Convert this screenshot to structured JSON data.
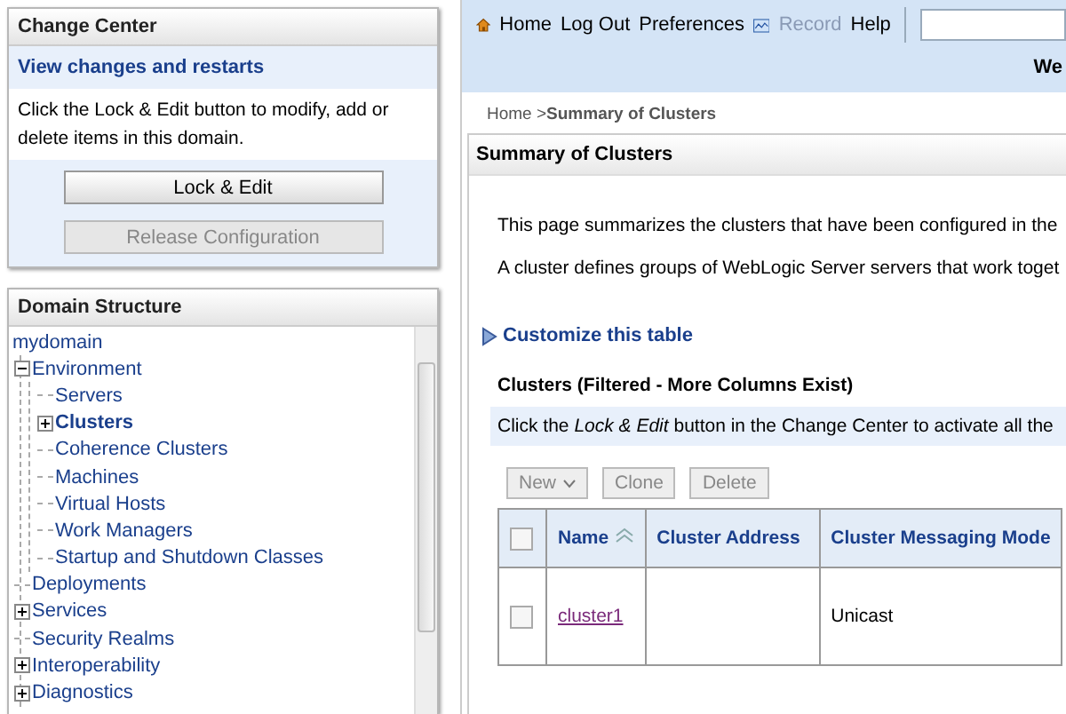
{
  "change_center": {
    "title": "Change Center",
    "subtitle": "View changes and restarts",
    "text": "Click the Lock & Edit button to modify, add or delete items in this domain.",
    "buttons": [
      {
        "label": "Lock & Edit",
        "disabled": false
      },
      {
        "label": "Release Configuration",
        "disabled": true
      }
    ]
  },
  "domain_structure": {
    "title": "Domain Structure",
    "tree": [
      {
        "label": "mydomain",
        "selected": false,
        "children": [
          {
            "label": "Environment",
            "selected": false,
            "expanded": true,
            "children": [
              {
                "label": "Servers",
                "selected": false
              },
              {
                "label": "Clusters",
                "selected": true,
                "expanded": false
              },
              {
                "label": "Coherence Clusters",
                "selected": false
              },
              {
                "label": "Machines",
                "selected": false
              },
              {
                "label": "Virtual Hosts",
                "selected": false
              },
              {
                "label": "Work Managers",
                "selected": false
              },
              {
                "label": "Startup and Shutdown Classes",
                "selected": false
              }
            ]
          },
          {
            "label": "Deployments",
            "selected": false
          },
          {
            "label": "Services",
            "selected": false,
            "expanded": false
          },
          {
            "label": "Security Realms",
            "selected": false
          },
          {
            "label": "Interoperability",
            "selected": false,
            "expanded": false
          },
          {
            "label": "Diagnostics",
            "selected": false,
            "expanded": false
          }
        ]
      }
    ]
  },
  "toolbar": {
    "links": [
      {
        "label": "Home",
        "kind": "home",
        "disabled": false
      },
      {
        "label": "Log Out",
        "disabled": false
      },
      {
        "label": "Preferences",
        "disabled": false
      },
      {
        "label": "Record",
        "kind": "record",
        "disabled": true
      },
      {
        "label": "Help",
        "disabled": false
      }
    ],
    "banner": "We"
  },
  "breadcrumb": {
    "home": "Home >",
    "current": "Summary of Clusters"
  },
  "summary": {
    "title": "Summary of Clusters",
    "paragraphs": [
      "This page summarizes the clusters that have been configured in the",
      "A cluster defines groups of WebLogic Server servers that work toget"
    ],
    "customize": "Customize this table",
    "table_title": "Clusters (Filtered - More Columns Exist)",
    "info": "Click the *Lock & Edit* button in the Change Center to activate all the",
    "buttons": [
      {
        "label": "New",
        "dropdown": true,
        "disabled": true
      },
      {
        "label": "Clone",
        "disabled": true
      },
      {
        "label": "Delete",
        "disabled": true
      }
    ],
    "table": {
      "columns": [
        {
          "label": "Name",
          "sorted": true
        },
        {
          "label": "Cluster Address",
          "sorted": false
        },
        {
          "label": "Cluster Messaging Mode",
          "sorted": false
        }
      ],
      "header_checked": false,
      "rows": [
        {
          "checked": false,
          "cells": [
            "cluster1",
            "",
            "Unicast"
          ]
        }
      ]
    }
  }
}
